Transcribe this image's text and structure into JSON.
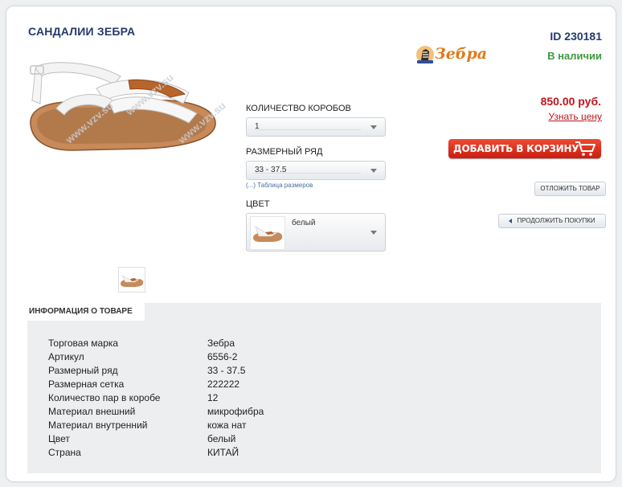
{
  "product": {
    "title": "САНДАЛИИ ЗЕБРА",
    "id_label": "ID 230181",
    "stock": "В наличии",
    "brand_logo": "Зебра",
    "watermark": "www.vzv.su"
  },
  "options": {
    "boxes_label": "КОЛИЧЕСТВО КОРОБОВ",
    "boxes_value": "1",
    "size_label": "РАЗМЕРНЫЙ РЯД",
    "size_value": "33 - 37.5",
    "size_table_link": "(...) Таблица размеров",
    "color_label": "ЦВЕТ",
    "color_value": "белый"
  },
  "buy": {
    "price": "850.00 руб.",
    "ask_price": "Узнать цену",
    "add_to_cart": "ДОБАВИТЬ В КОРЗИНУ",
    "postpone": "ОТЛОЖИТЬ ТОВАР",
    "continue": "ПРОДОЛЖИТЬ ПОКУПКИ"
  },
  "info": {
    "tab": "ИНФОРМАЦИЯ О ТОВАРЕ",
    "rows": [
      {
        "k": "Торговая марка",
        "v": "Зебра"
      },
      {
        "k": "Артикул",
        "v": "6556-2"
      },
      {
        "k": "Размерный ряд",
        "v": "33 - 37.5"
      },
      {
        "k": "Размерная сетка",
        "v": "222222"
      },
      {
        "k": "Количество пар в коробе",
        "v": "12"
      },
      {
        "k": "Материал внешний",
        "v": "микрофибра"
      },
      {
        "k": "Материал внутренний",
        "v": "кожа нат"
      },
      {
        "k": "Цвет",
        "v": "белый"
      },
      {
        "k": "Страна",
        "v": "КИТАЙ"
      }
    ]
  },
  "colors": {
    "title": "#243b6e",
    "stock": "#3e9a3e",
    "price": "#c0141b",
    "cart": "#d9301f"
  }
}
